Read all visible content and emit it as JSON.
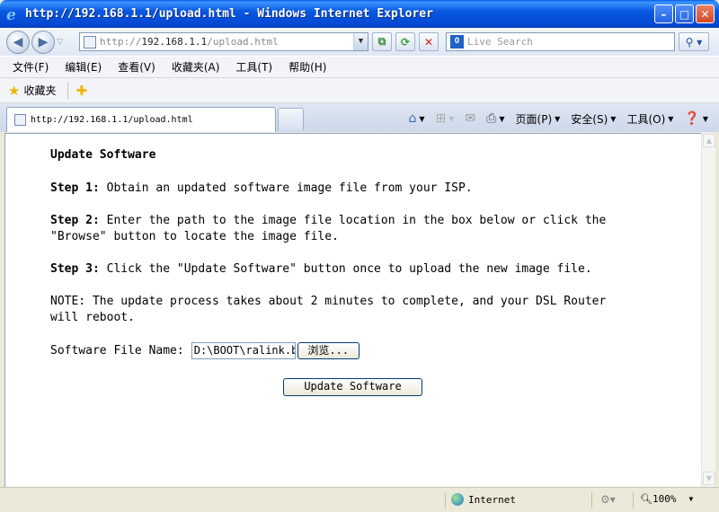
{
  "window": {
    "title": "http://192.168.1.1/upload.html - Windows Internet Explorer",
    "minimize_glyph": "–",
    "maximize_glyph": "□",
    "close_glyph": "✕"
  },
  "nav": {
    "address_prefix": "http://",
    "address_host": "192.168.1.1",
    "address_path": "/upload.html",
    "search_placeholder": "Live Search"
  },
  "menu": {
    "items": [
      "文件(F)",
      "编辑(E)",
      "查看(V)",
      "收藏夹(A)",
      "工具(T)",
      "帮助(H)"
    ]
  },
  "favorites": {
    "label": "收藏夹"
  },
  "tabs": {
    "active_tab_label": "http://192.168.1.1/upload.html"
  },
  "commands": {
    "page": "页面(P)",
    "safety": "安全(S)",
    "tools": "工具(O)"
  },
  "content": {
    "title": "Update Software",
    "step1_label": "Step 1:",
    "step1_text": " Obtain an updated software image file from your ISP.",
    "step2_label": "Step 2:",
    "step2_text": " Enter the path to the image file location in the box below or click the \"Browse\" button to locate the image file.",
    "step3_label": "Step 3:",
    "step3_text": " Click the \"Update Software\" button once to upload the new image file.",
    "note": "NOTE: The update process takes about 2 minutes to complete, and your DSL Router will reboot.",
    "file_label": "Software File Name:",
    "file_value": "D:\\BOOT\\ralink.b",
    "browse_label": "浏览...",
    "update_button": "Update Software"
  },
  "status": {
    "zone": "Internet",
    "zoom": "100%"
  },
  "colors": {
    "titlebar": "#0548d4",
    "accent": "#3d6bb3"
  }
}
